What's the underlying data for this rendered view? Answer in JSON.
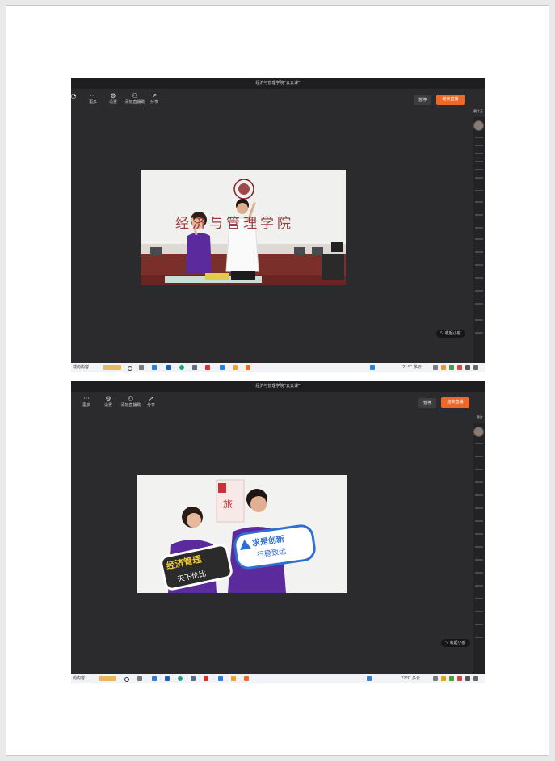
{
  "screens": [
    {
      "window_title": "经济与管理学院“云云课”",
      "tools": [
        {
          "label": "",
          "icon": "person-icon"
        },
        {
          "label": "更多",
          "icon": "more-icon"
        },
        {
          "label": "设置",
          "icon": "settings-icon"
        },
        {
          "label": "添加直播助",
          "icon": "add-assistant-icon"
        },
        {
          "label": "分享",
          "icon": "share-icon"
        }
      ],
      "pause_label": "暂停",
      "end_label": "结束直播",
      "side_tab": "载片互",
      "mini_label": "收起小窗",
      "banner_text": "经济与管理学院",
      "taskbar": {
        "left_text": "载的内容",
        "weather": "21°C 多云"
      }
    },
    {
      "window_title": "经济与管理学院“云云课”",
      "tools": [
        {
          "label": "更多",
          "icon": "more-icon"
        },
        {
          "label": "设置",
          "icon": "settings-icon"
        },
        {
          "label": "添加直播助",
          "icon": "add-assistant-icon"
        },
        {
          "label": "分享",
          "icon": "share-icon"
        }
      ],
      "pause_label": "暂停",
      "end_label": "结束直播",
      "side_tab": "载片",
      "mini_label": "收起小窗",
      "sign_left": "经济管理",
      "sign_left_sub": "天下伦比",
      "sign_right": "求是创新",
      "sign_right_sub": "行稳致远",
      "taskbar": {
        "left_text": "的内容",
        "weather": "22°C 多云"
      }
    }
  ],
  "colors": {
    "accent": "#f0672a",
    "background": "#2b2b2d",
    "taskbar": "#f1f3f6",
    "shirt": "#5b2b9e"
  }
}
